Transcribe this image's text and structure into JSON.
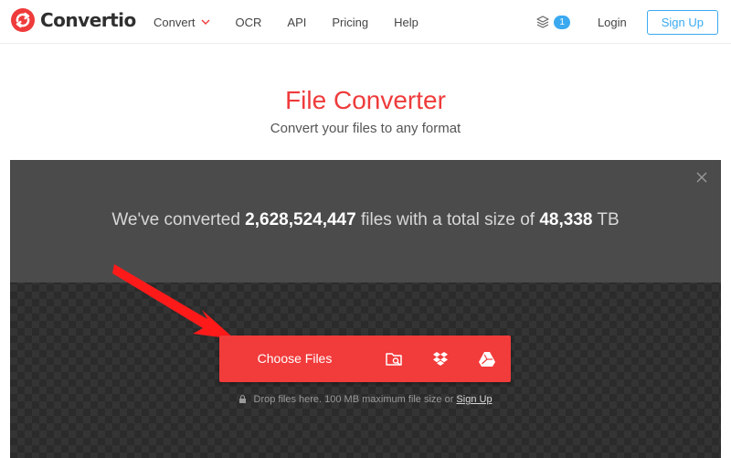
{
  "brand": {
    "name": "Convertio",
    "logo_icon": "convertio-logo-icon",
    "accent_color": "#ef3b3b"
  },
  "nav": {
    "items": [
      {
        "label": "Convert",
        "has_dropdown": true
      },
      {
        "label": "OCR"
      },
      {
        "label": "API"
      },
      {
        "label": "Pricing"
      },
      {
        "label": "Help"
      }
    ]
  },
  "user_nav": {
    "queue_icon": "layers-icon",
    "queue_count": "1",
    "login_label": "Login",
    "signup_label": "Sign Up",
    "signup_color": "#3ba9f0"
  },
  "hero": {
    "title": "File Converter",
    "subtitle": "Convert your files to any format"
  },
  "stats": {
    "prefix": "We've converted",
    "files_count": "2,628,524,447",
    "middle": "files with a total size of",
    "total_size": "48,338",
    "unit": "TB"
  },
  "upload": {
    "choose_files_label": "Choose Files",
    "sources": [
      {
        "icon": "folder-search-icon",
        "name": "From device"
      },
      {
        "icon": "dropbox-icon",
        "name": "Dropbox"
      },
      {
        "icon": "google-drive-icon",
        "name": "Google Drive"
      }
    ],
    "hint_text": "Drop files here. 100 MB maximum file size or",
    "hint_link": "Sign Up"
  }
}
